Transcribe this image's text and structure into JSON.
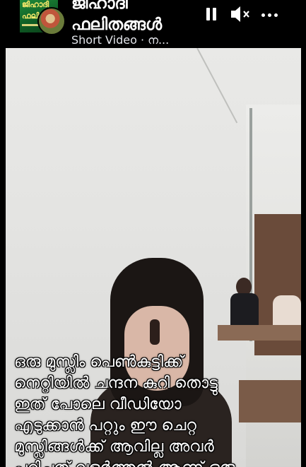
{
  "header": {
    "page_title_line1": "ജിഹാദി",
    "page_title_line2": "ഫലിതങ്ങൾ",
    "subtitle": "Short Video · ന...",
    "avatar_text_line1": "ജിഹാദി",
    "avatar_text_line2": "ഫലിതങ്ങ"
  },
  "controls": {
    "pause": "pause-icon",
    "mute": "speaker-muted-icon",
    "more": "more-icon"
  },
  "video": {
    "caption_lines": [
      "ഒരു മുസ്ലിം പെൺകുട്ടിക്ക്",
      "നെറ്റിയിൽ ചന്ദന കുറി തൊട്ടു",
      "ഇത് പോലെ വീഡിയോ",
      "എടുക്കാൻ പറ്റും ഈ ചെറ്റ",
      "മുസ്ലിങ്ങൾക്ക് ആവില്ല അവർ",
      "പഠിച്ചത് വളർത്തൽ ആണ് ഒരു"
    ]
  }
}
